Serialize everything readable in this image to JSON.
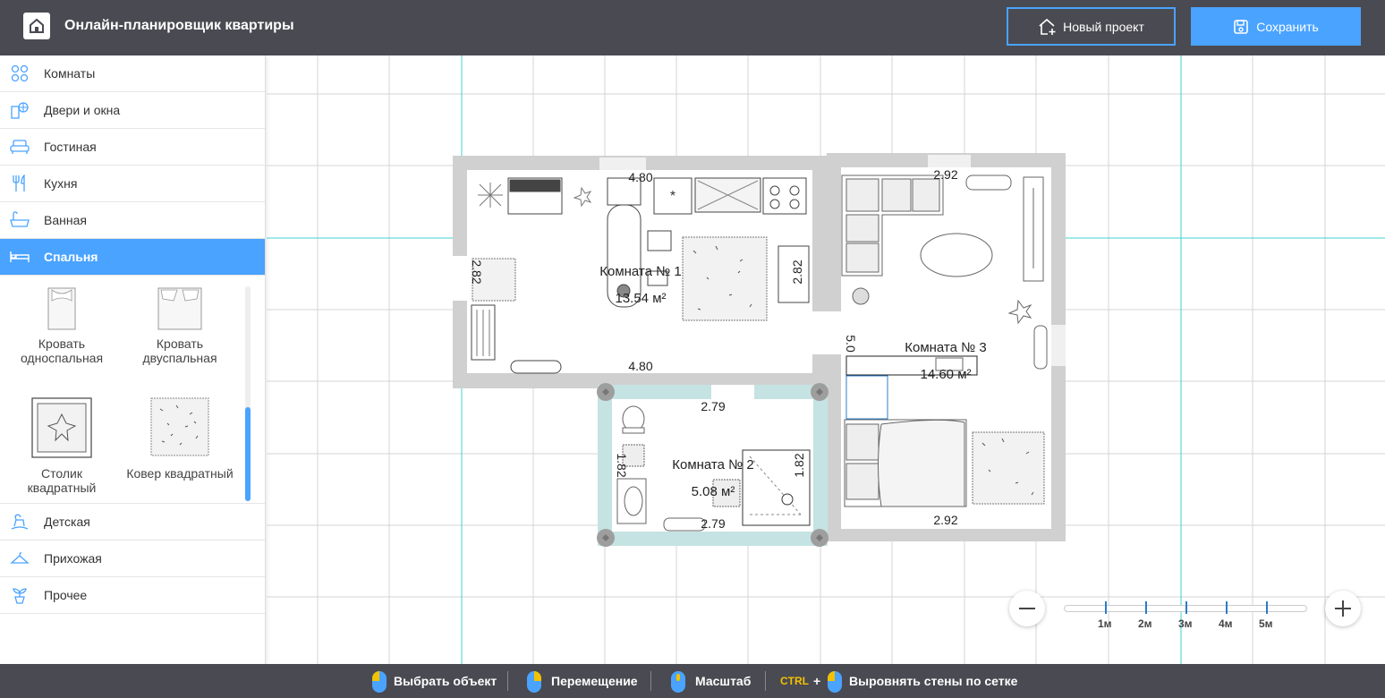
{
  "header": {
    "title": "Онлайн-планировщик квартиры",
    "new_project": "Новый проект",
    "save": "Сохранить"
  },
  "sidebar": {
    "categories_top": [
      {
        "label": "Комнаты",
        "icon": "rooms-icon"
      },
      {
        "label": "Двери и окна",
        "icon": "doors-windows-icon"
      },
      {
        "label": "Гостиная",
        "icon": "sofa-icon"
      },
      {
        "label": "Кухня",
        "icon": "fork-knife-icon"
      },
      {
        "label": "Ванная",
        "icon": "bathtub-icon"
      },
      {
        "label": "Спальня",
        "icon": "bed-icon",
        "active": true
      }
    ],
    "items": [
      {
        "label": "Кровать односпальная",
        "line1": "Кровать",
        "line2": "односпальная"
      },
      {
        "label": "Кровать двуспальная",
        "line1": "Кровать",
        "line2": "двуспальная"
      },
      {
        "label": "Столик квадратный",
        "line1": "Столик",
        "line2": "квадратный"
      },
      {
        "label": "Ковер квадратный",
        "line1": "Ковер квадратный",
        "line2": ""
      }
    ],
    "categories_bottom": [
      {
        "label": "Детская",
        "icon": "rocking-horse-icon"
      },
      {
        "label": "Прихожая",
        "icon": "hanger-icon"
      },
      {
        "label": "Прочее",
        "icon": "plant-icon"
      }
    ]
  },
  "plan": {
    "room1": {
      "name": "Комната №  1",
      "area": "13.54 м²",
      "dim_top": "4.80",
      "dim_bottom": "4.80",
      "dim_left": "2.82",
      "dim_right": "2.82"
    },
    "room2": {
      "name": "Комната №  2",
      "area": "5.08 м²",
      "dim_top": "2.79",
      "dim_bottom": "2.79",
      "dim_left": "1.82",
      "dim_right": "1.82"
    },
    "room3": {
      "name": "Комната №  3",
      "area": "14.60 м²",
      "dim_top": "2.92",
      "dim_bottom": "2.92",
      "dim_left": "5.0"
    }
  },
  "scale": {
    "labels": [
      "1м",
      "2м",
      "3м",
      "4м",
      "5м"
    ]
  },
  "footer": {
    "select": "Выбрать объект",
    "move": "Перемещение",
    "zoom": "Масштаб",
    "ctrl": "CTRL",
    "plus": "+",
    "align": "Выровнять стены по сетке"
  },
  "colors": {
    "accent": "#4aa3ff",
    "header_bg": "#4a4a52",
    "wall": "#d0d0d0",
    "selected_wall": "#c5e3e3",
    "guide": "#40d0d0"
  }
}
